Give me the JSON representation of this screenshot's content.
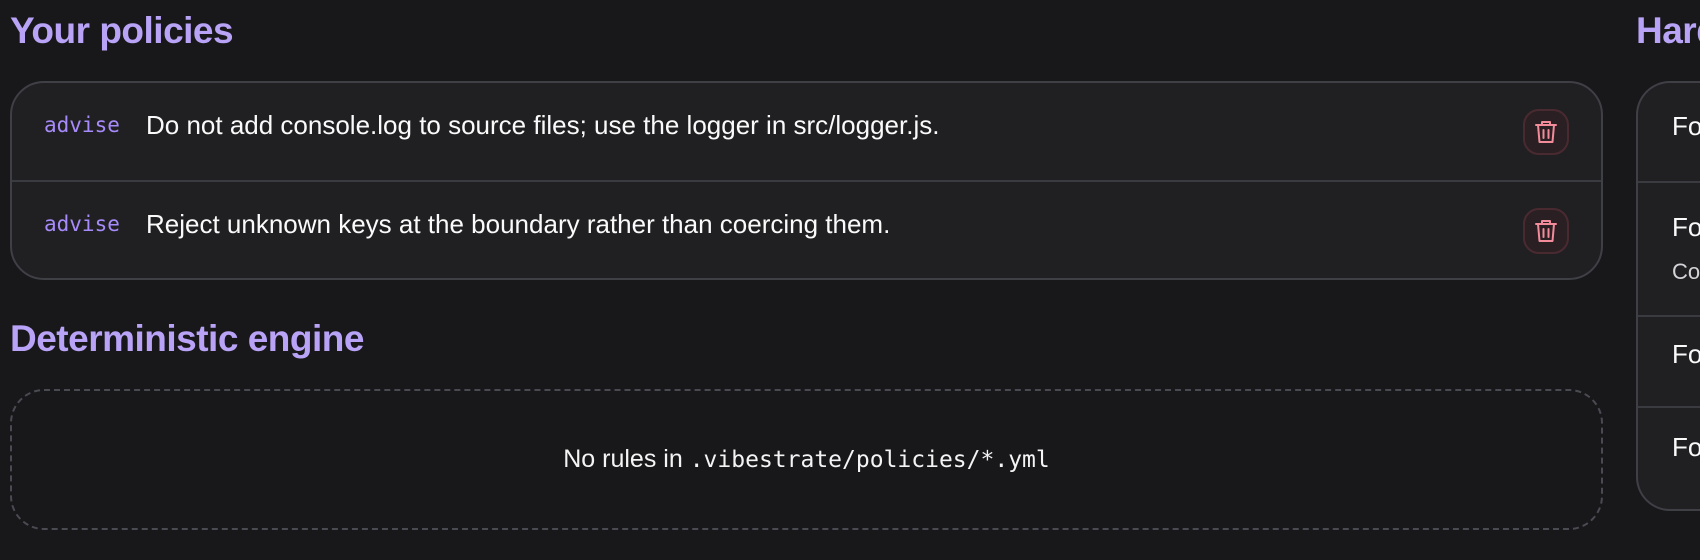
{
  "policies_section": {
    "title": "Your policies",
    "items": [
      {
        "tag": "advise",
        "text": "Do not add console.log to source files; use the logger in src/logger.js."
      },
      {
        "tag": "advise",
        "text": "Reject unknown keys at the boundary rather than coercing them."
      }
    ]
  },
  "engine_section": {
    "title": "Deterministic engine",
    "empty_prefix": "No rules in",
    "empty_path": ".vibestrate/policies/*.yml"
  },
  "right_panel": {
    "title_partial": "Hard",
    "items": [
      "Fo",
      "Fo",
      "Fo",
      "Fo"
    ],
    "subtext_partial": "Co"
  },
  "colors": {
    "background": "#18181b",
    "accent": "#b9a3f7",
    "tag": "#a78bfa",
    "danger": "#f28b9a"
  },
  "icons": {
    "delete": "trash-icon"
  }
}
